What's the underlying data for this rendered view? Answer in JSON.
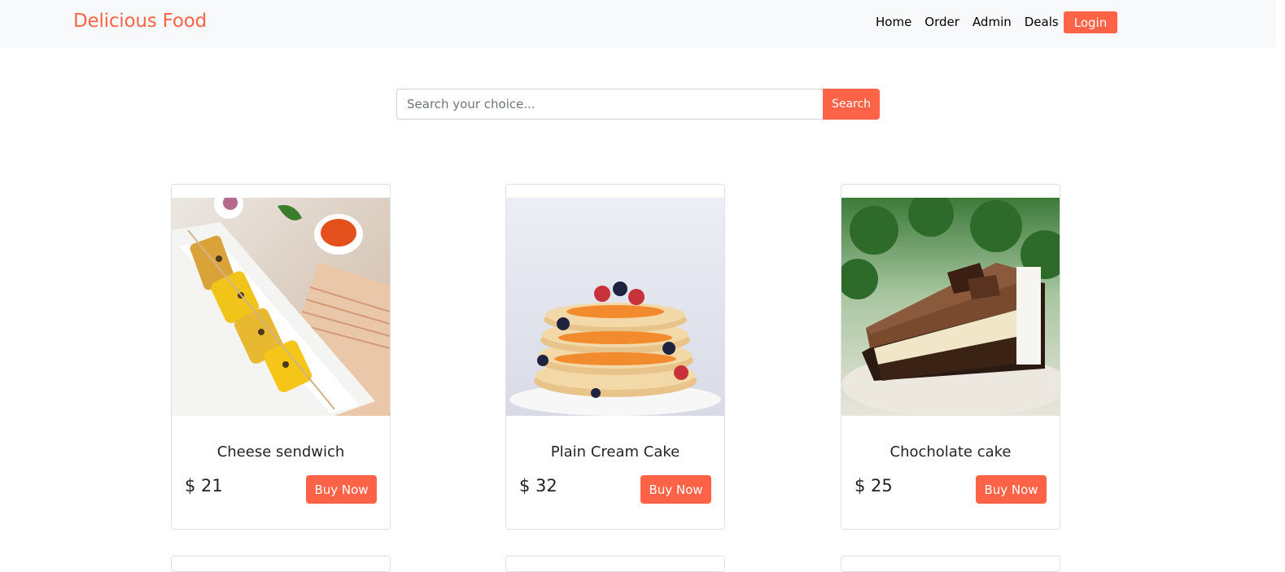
{
  "brand": {
    "name": "Delicious Food",
    "color": "#ff6347"
  },
  "nav": {
    "links": [
      "Home",
      "Order",
      "Admin",
      "Deals"
    ],
    "login_label": "Login"
  },
  "search": {
    "placeholder": "Search your choice...",
    "value": "",
    "button_label": "Search"
  },
  "products": [
    {
      "name": "Cheese sendwich",
      "price": "$ 21",
      "button_label": "Buy Now",
      "image": "grilled-paneer-skewers-photo"
    },
    {
      "name": "Plain Cream Cake",
      "price": "$ 32",
      "button_label": "Buy Now",
      "image": "pancake-stack-with-berries-photo"
    },
    {
      "name": "Chocholate cake",
      "price": "$ 25",
      "button_label": "Buy Now",
      "image": "chocolate-cake-slice-photo"
    }
  ],
  "colors": {
    "accent": "#ff6347",
    "navbar_bg": "#f8f9fa",
    "border": "#dee2e6"
  }
}
